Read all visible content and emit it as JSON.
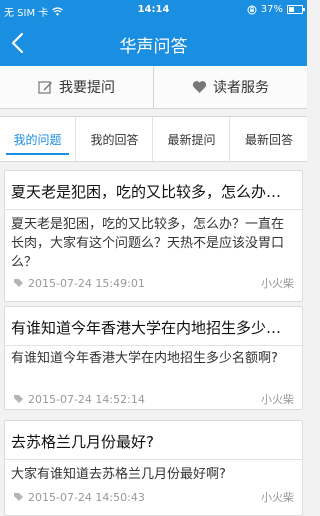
{
  "status_bar": {
    "carrier": "无 SIM 卡",
    "time": "14:14",
    "battery": "37%",
    "battery_level": 0.37,
    "icons": [
      "wifi-icon",
      "rotation-lock-icon",
      "battery-icon"
    ]
  },
  "nav": {
    "title": "华声问答",
    "back_icon": "chevron-left-icon"
  },
  "actions": {
    "ask": {
      "label": "我要提问",
      "icon": "edit-icon"
    },
    "service": {
      "label": "读者服务",
      "icon": "heart-icon"
    }
  },
  "tabs": [
    {
      "label": "我的问题",
      "active": true
    },
    {
      "label": "我的回答",
      "active": false
    },
    {
      "label": "最新提问",
      "active": false
    },
    {
      "label": "最新回答",
      "active": false
    }
  ],
  "questions": [
    {
      "title": "夏天老是犯困，吃的又比较多，怎么办？一直在长肉，大家有这个问题么？天热不是应该没胃口么？",
      "body": "夏天老是犯困，吃的又比较多，怎么办？一直在长肉，大家有这个问题么？天热不是应该没胃口么？",
      "time": "2015-07-24 15:49:01",
      "author": "小火柴"
    },
    {
      "title": "有谁知道今年香港大学在内地招生多少名额啊?",
      "body": "有谁知道今年香港大学在内地招生多少名额啊?",
      "time": "2015-07-24 14:52:14",
      "author": "小火柴"
    },
    {
      "title": "去苏格兰几月份最好?",
      "body": "大家有谁知道去苏格兰几月份最好啊?",
      "time": "2015-07-24 14:50:43",
      "author": "小火柴"
    }
  ],
  "colors": {
    "primary": "#1a8ee0",
    "background": "#f2f2f2"
  }
}
